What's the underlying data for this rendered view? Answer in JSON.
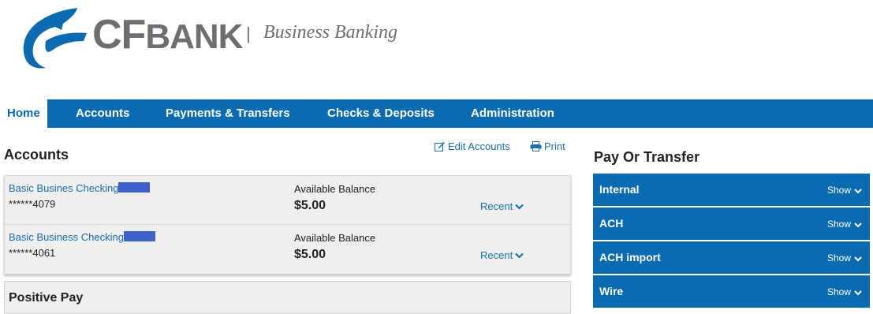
{
  "brand": {
    "logo_cf": "CF",
    "logo_bank": "BANK",
    "separator": "|",
    "tagline": "Business Banking",
    "primary_color": "#0a6bb1",
    "gray_color": "#6d6e71"
  },
  "nav": {
    "items": [
      {
        "label": "Home",
        "active": true
      },
      {
        "label": "Accounts",
        "active": false
      },
      {
        "label": "Payments & Transfers",
        "active": false
      },
      {
        "label": "Checks & Deposits",
        "active": false
      },
      {
        "label": "Administration",
        "active": false
      }
    ]
  },
  "accounts_section": {
    "title": "Accounts",
    "edit_label": "Edit Accounts",
    "edit_icon": "edit-icon",
    "print_label": "Print",
    "print_icon": "printer-icon",
    "rows": [
      {
        "name": "Basic Busines Checking",
        "number": "******4079",
        "balance_label": "Available Balance",
        "balance": "$5.00",
        "recent_label": "Recent"
      },
      {
        "name": "Basic Business Checking",
        "number": "******4061",
        "balance_label": "Available Balance",
        "balance": "$5.00",
        "recent_label": "Recent"
      }
    ]
  },
  "positive_pay": {
    "title": "Positive Pay"
  },
  "pay_or_transfer": {
    "title": "Pay Or Transfer",
    "items": [
      {
        "label": "Internal",
        "action": "Show"
      },
      {
        "label": "ACH",
        "action": "Show"
      },
      {
        "label": "ACH import",
        "action": "Show"
      },
      {
        "label": "Wire",
        "action": "Show"
      }
    ]
  }
}
